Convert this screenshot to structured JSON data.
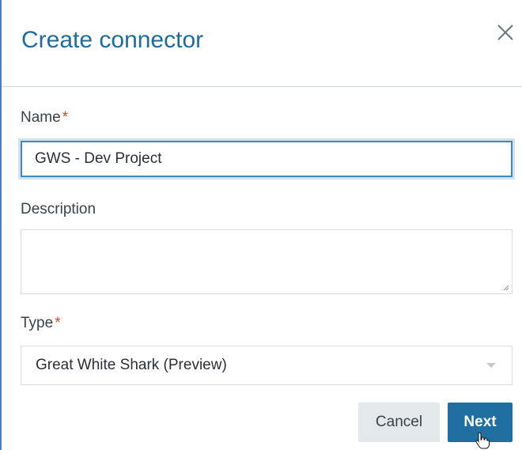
{
  "dialog": {
    "title": "Create connector",
    "close_icon": "close-icon"
  },
  "fields": {
    "name": {
      "label": "Name",
      "required_marker": "*",
      "value": "GWS - Dev Project"
    },
    "description": {
      "label": "Description",
      "value": ""
    },
    "type": {
      "label": "Type",
      "required_marker": "*",
      "selected": "Great White Shark (Preview)"
    }
  },
  "actions": {
    "cancel_label": "Cancel",
    "next_label": "Next"
  },
  "colors": {
    "accent": "#1f6fa3",
    "title": "#1f6b9c",
    "required": "#d9472b",
    "focus_border": "#3e8cbf"
  }
}
